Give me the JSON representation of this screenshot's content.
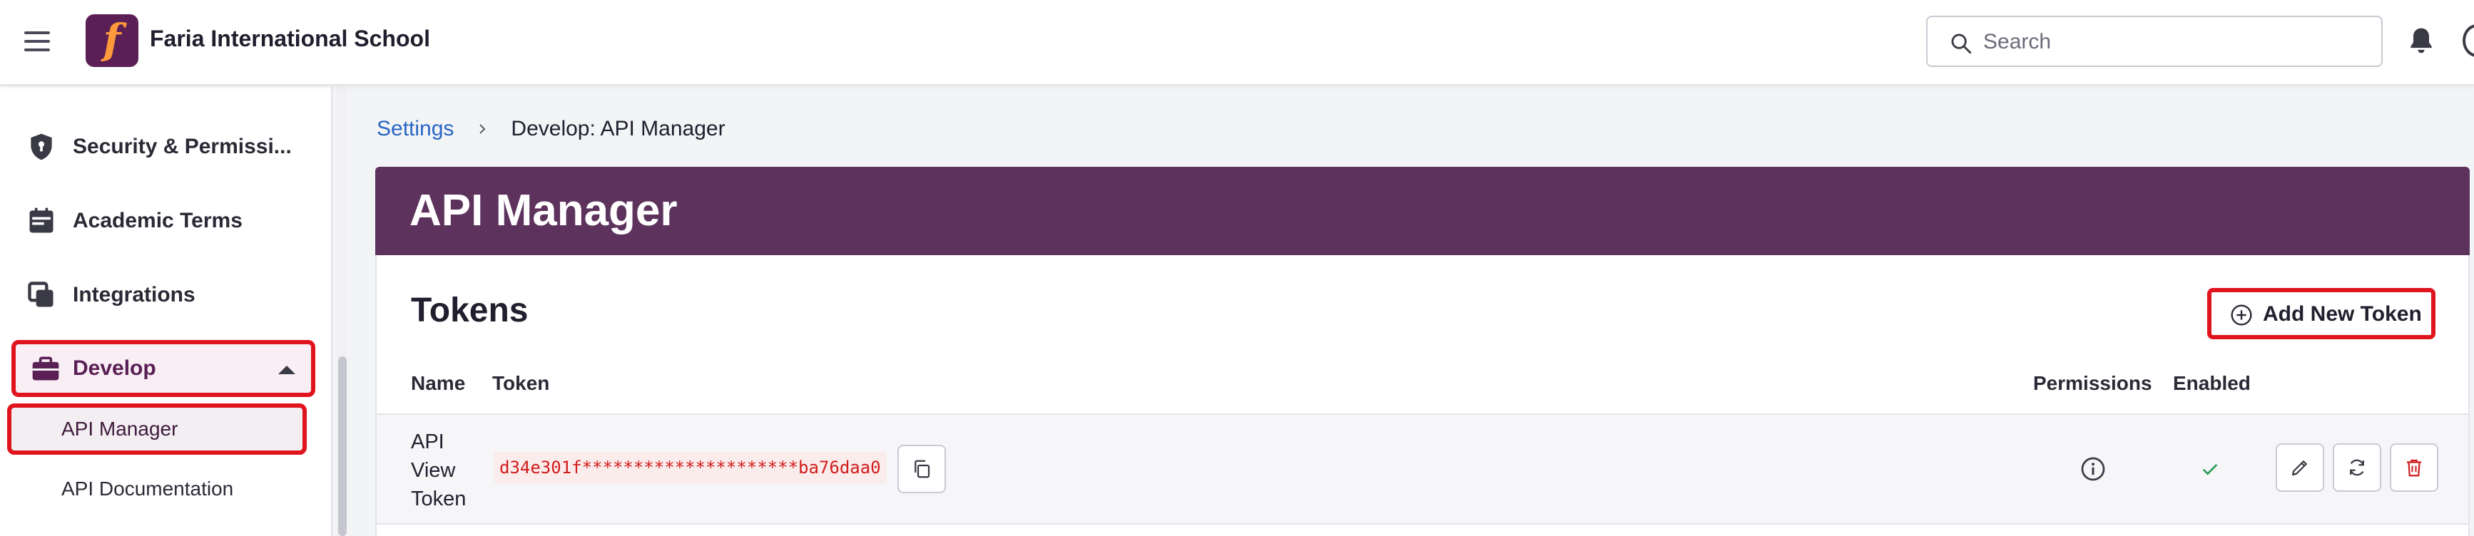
{
  "topbar": {
    "school_name": "Faria International School",
    "logo_letter": "f",
    "search_placeholder": "Search"
  },
  "sidebar": {
    "items": [
      {
        "label": "Security & Permissi...",
        "icon": "shield-icon"
      },
      {
        "label": "Academic Terms",
        "icon": "calendar-icon"
      },
      {
        "label": "Integrations",
        "icon": "integrations-icon"
      },
      {
        "label": "Develop",
        "icon": "briefcase-icon",
        "expanded": true
      }
    ],
    "sub_items": [
      {
        "label": "API Manager",
        "active": true
      },
      {
        "label": "API Documentation",
        "active": false
      }
    ]
  },
  "breadcrumb": {
    "root": "Settings",
    "current": "Develop: API Manager"
  },
  "page": {
    "title": "API Manager"
  },
  "tokens": {
    "section_title": "Tokens",
    "add_button_label": "Add New Token",
    "columns": {
      "name": "Name",
      "token": "Token",
      "permissions": "Permissions",
      "enabled": "Enabled"
    },
    "rows": [
      {
        "name": "API View Token",
        "token": "d34e301f*********************ba76daa0",
        "enabled": true
      }
    ]
  },
  "colors": {
    "brand_purple": "#5d335e",
    "link_blue": "#2966c4",
    "highlight_red": "#e0141e",
    "token_red": "#d21c1c",
    "success_green": "#2e9a5a"
  }
}
